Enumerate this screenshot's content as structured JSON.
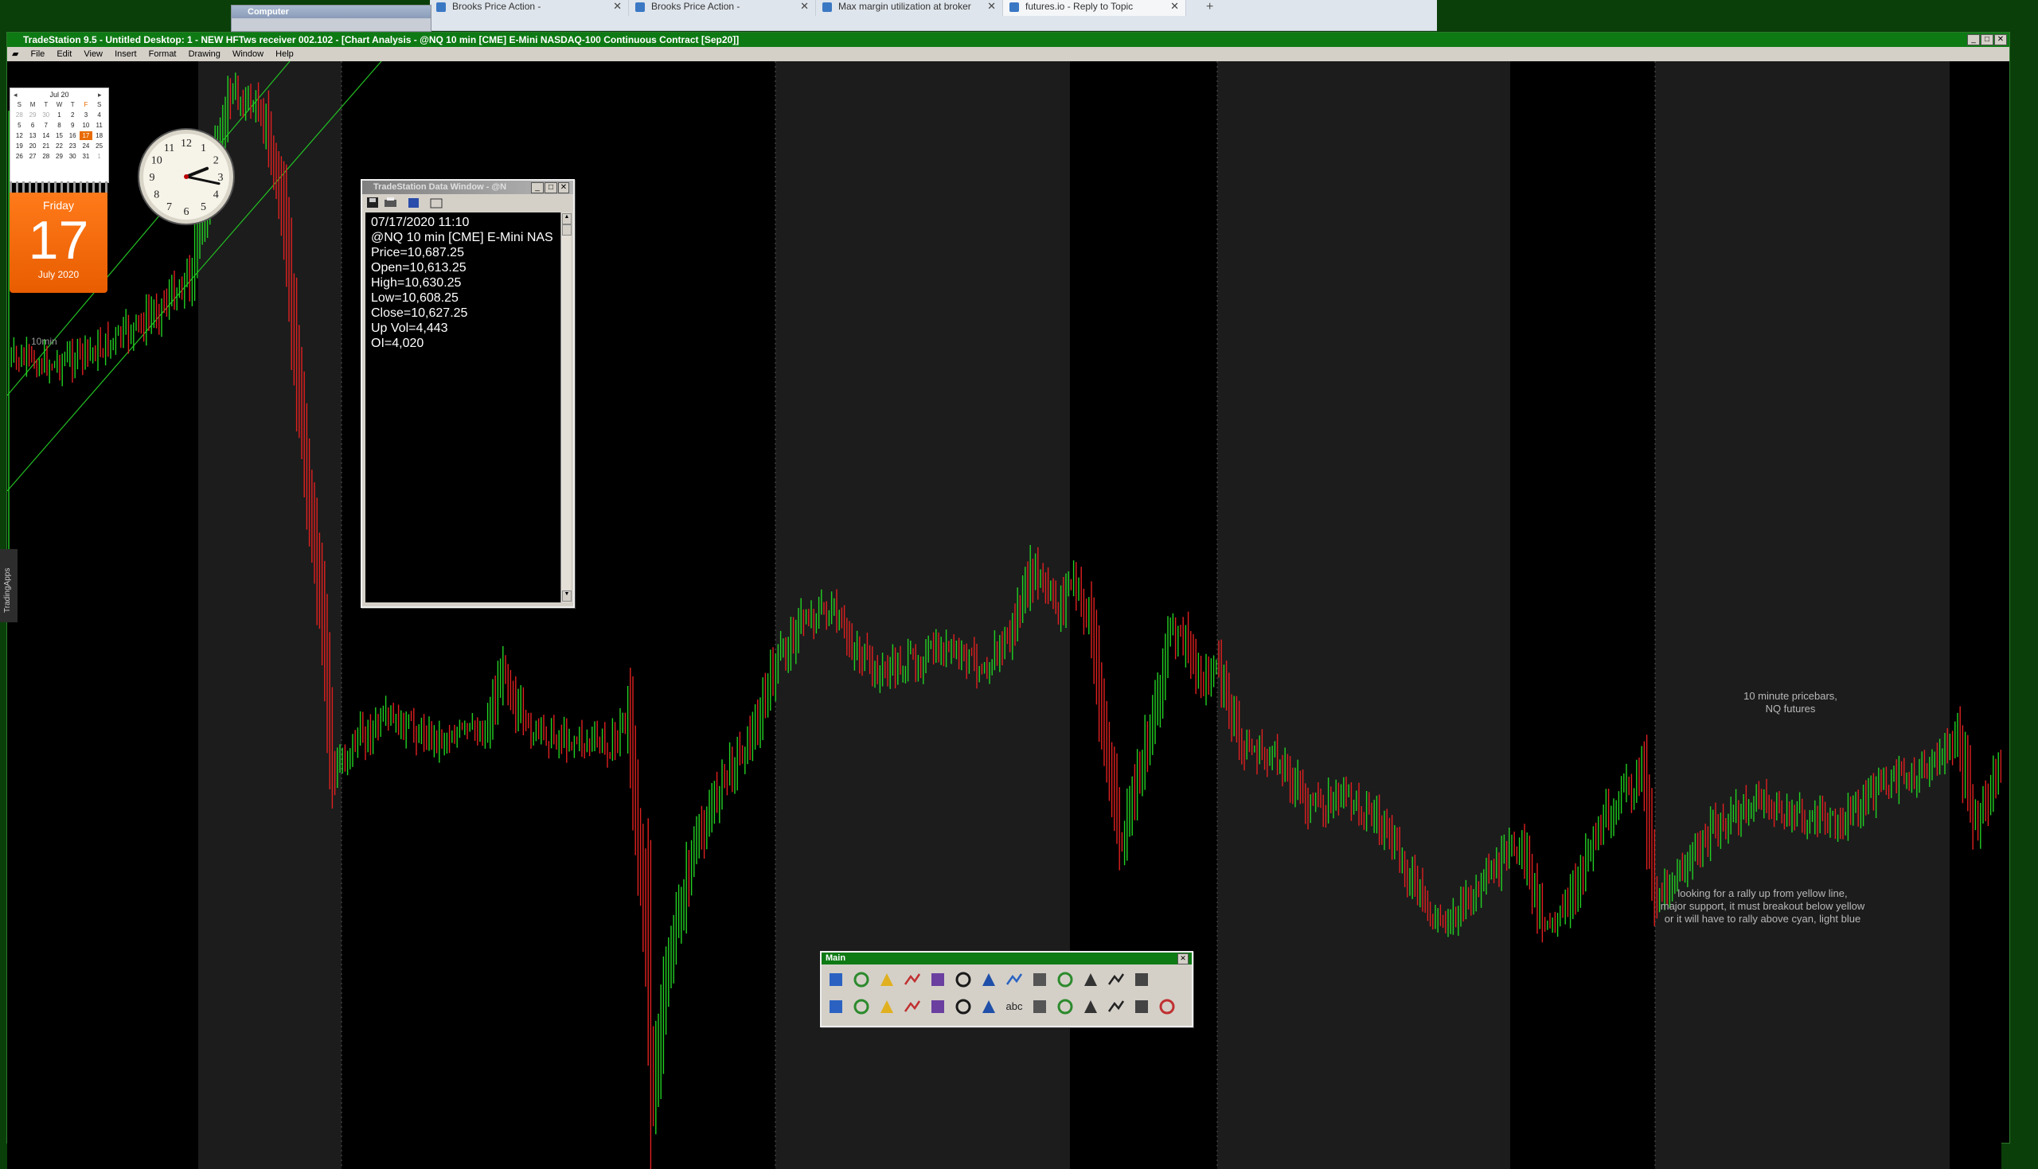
{
  "browser": {
    "tabs": [
      {
        "label": "Brooks Price Action -"
      },
      {
        "label": "Brooks Price Action -"
      },
      {
        "label": "Max margin utilization at broker"
      },
      {
        "label": "futures.io - Reply to Topic"
      }
    ]
  },
  "computer_window": {
    "title": "Computer"
  },
  "app": {
    "title": "TradeStation 9.5 - Untitled Desktop: 1 - NEW HFTws receiver 002.102 - [Chart Analysis - @NQ 10 min [CME] E-Mini NASDAQ-100 Continuous Contract [Sep20]]",
    "menu": [
      "File",
      "Edit",
      "View",
      "Insert",
      "Format",
      "Drawing",
      "Window",
      "Help"
    ],
    "side_tab": "TradingApps"
  },
  "calendar": {
    "month": "Jul 20",
    "weekdays": [
      "S",
      "M",
      "T",
      "W",
      "T",
      "F",
      "S"
    ],
    "weeks": [
      [
        "28",
        "29",
        "30",
        "1",
        "2",
        "3",
        "4"
      ],
      [
        "5",
        "6",
        "7",
        "8",
        "9",
        "10",
        "11"
      ],
      [
        "12",
        "13",
        "14",
        "15",
        "16",
        "17",
        "18"
      ],
      [
        "19",
        "20",
        "21",
        "22",
        "23",
        "24",
        "25"
      ],
      [
        "26",
        "27",
        "28",
        "29",
        "30",
        "31",
        "1"
      ]
    ],
    "highlight": "17",
    "day_name": "Friday",
    "day_number": "17",
    "month_year": "July 2020"
  },
  "clock": {
    "hour": 2,
    "minute": 17,
    "numerals": [
      "12",
      "1",
      "2",
      "3",
      "4",
      "5",
      "6",
      "7",
      "8",
      "9",
      "10",
      "11"
    ]
  },
  "chart": {
    "interval_label": "10min",
    "note_bars": "10 minute pricebars,\nNQ futures",
    "note_bars_lines": [
      "10 minute pricebars,",
      "NQ futures"
    ],
    "note_support_lines": [
      "looking for a rally up from yellow line,",
      "major support, it must breakout below yellow",
      "or it will have to rally above cyan, light blue"
    ],
    "colors": {
      "up": "#22d022",
      "down": "#e02020",
      "session_light": "#1c1c1c",
      "session_dark": "#000000",
      "channel": "#22c022"
    }
  },
  "data_window": {
    "title": "TradeStation Data Window - @N",
    "lines": [
      "07/17/2020 11:10",
      "@NQ 10 min [CME] E-Mini NAS",
      "Price=10,687.25",
      "Open=10,613.25",
      "High=10,630.25",
      "Low=10,608.25",
      "Close=10,627.25",
      "Up Vol=4,443",
      "OI=4,020"
    ]
  },
  "main_toolbar": {
    "title": "Main",
    "icons_row1": [
      "refresh-icon",
      "window-icon",
      "open-folder-icon",
      "copy-icon",
      "paste-icon",
      "new-doc-icon",
      "play-end-icon",
      "zoom-in-icon",
      "zoom-out-icon",
      "color-icon",
      "grid-icon",
      "curve-icon",
      "line-tool-icon"
    ],
    "icons_row2": [
      "dots-icon",
      "chart-icon",
      "sheet-icon",
      "bars-icon",
      "monitor-icon",
      "list-icon",
      "oval-icon",
      "text-icon",
      "pencil-icon",
      "trendline-icon",
      "fib-icon",
      "wave-icon",
      "scale-icon",
      "angle-icon"
    ],
    "text_tool": "abc"
  }
}
